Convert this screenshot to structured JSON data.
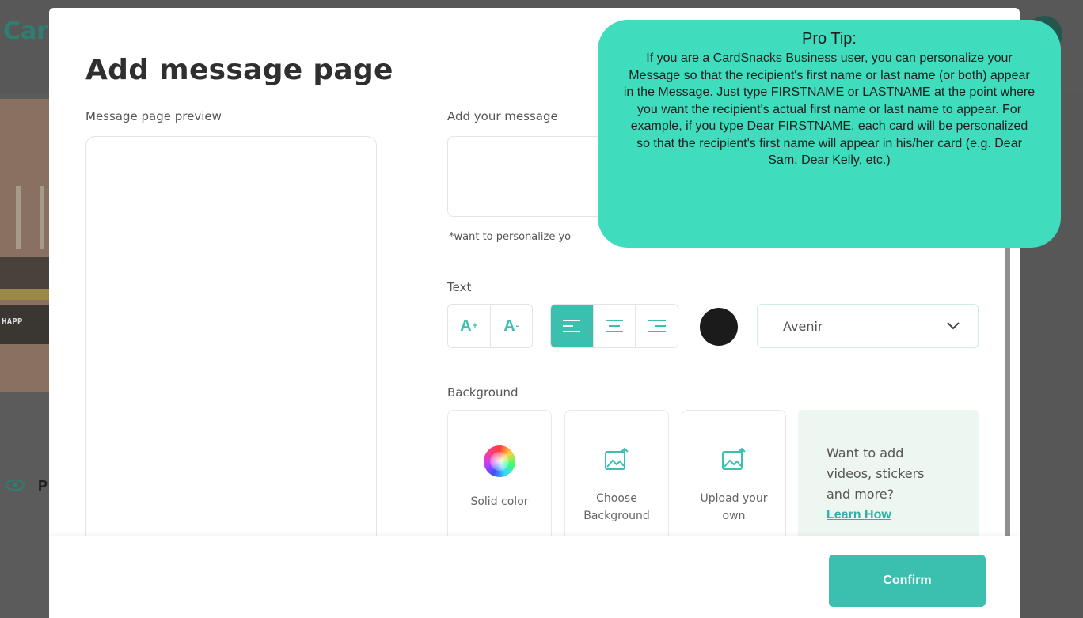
{
  "background_app": {
    "logo": "Car",
    "side_label": "P",
    "card_text": "HAPP"
  },
  "modal": {
    "title": "Add message page",
    "preview_label": "Message page preview",
    "message_label": "Add your message",
    "message_value": "",
    "personalize_hint": "*want to personalize yo",
    "text_section": {
      "label": "Text",
      "increase_label": "A",
      "increase_sup": "+",
      "decrease_label": "A",
      "decrease_sup": "-",
      "alignment_selected": "left",
      "color": "#1b1b1b",
      "font_value": "Avenir"
    },
    "background_section": {
      "label": "Background",
      "options": [
        {
          "label": "Solid color",
          "icon": "color-wheel-icon"
        },
        {
          "label": "Choose Background",
          "icon": "image-upload-icon"
        },
        {
          "label": "Upload your own",
          "icon": "image-upload-icon"
        }
      ],
      "promo": {
        "text": "Want to add videos, stickers and more?",
        "link": "Learn How"
      }
    },
    "confirm_label": "Confirm"
  },
  "protip": {
    "title": "Pro Tip:",
    "body": "If you are a CardSnacks Business user, you can personalize your Message so that the recipient's first name or last name (or both) appear in the Message. Just type FIRSTNAME or LASTNAME at the point where you want the recipient's actual first name or last name to appear. For example, if you type Dear FIRSTNAME, each card will be personalized so that the recipient's first name will appear in his/her card (e.g. Dear Sam, Dear Kelly, etc.)"
  },
  "colors": {
    "accent": "#3bbfaf",
    "protip_bg": "#40dcbe"
  }
}
